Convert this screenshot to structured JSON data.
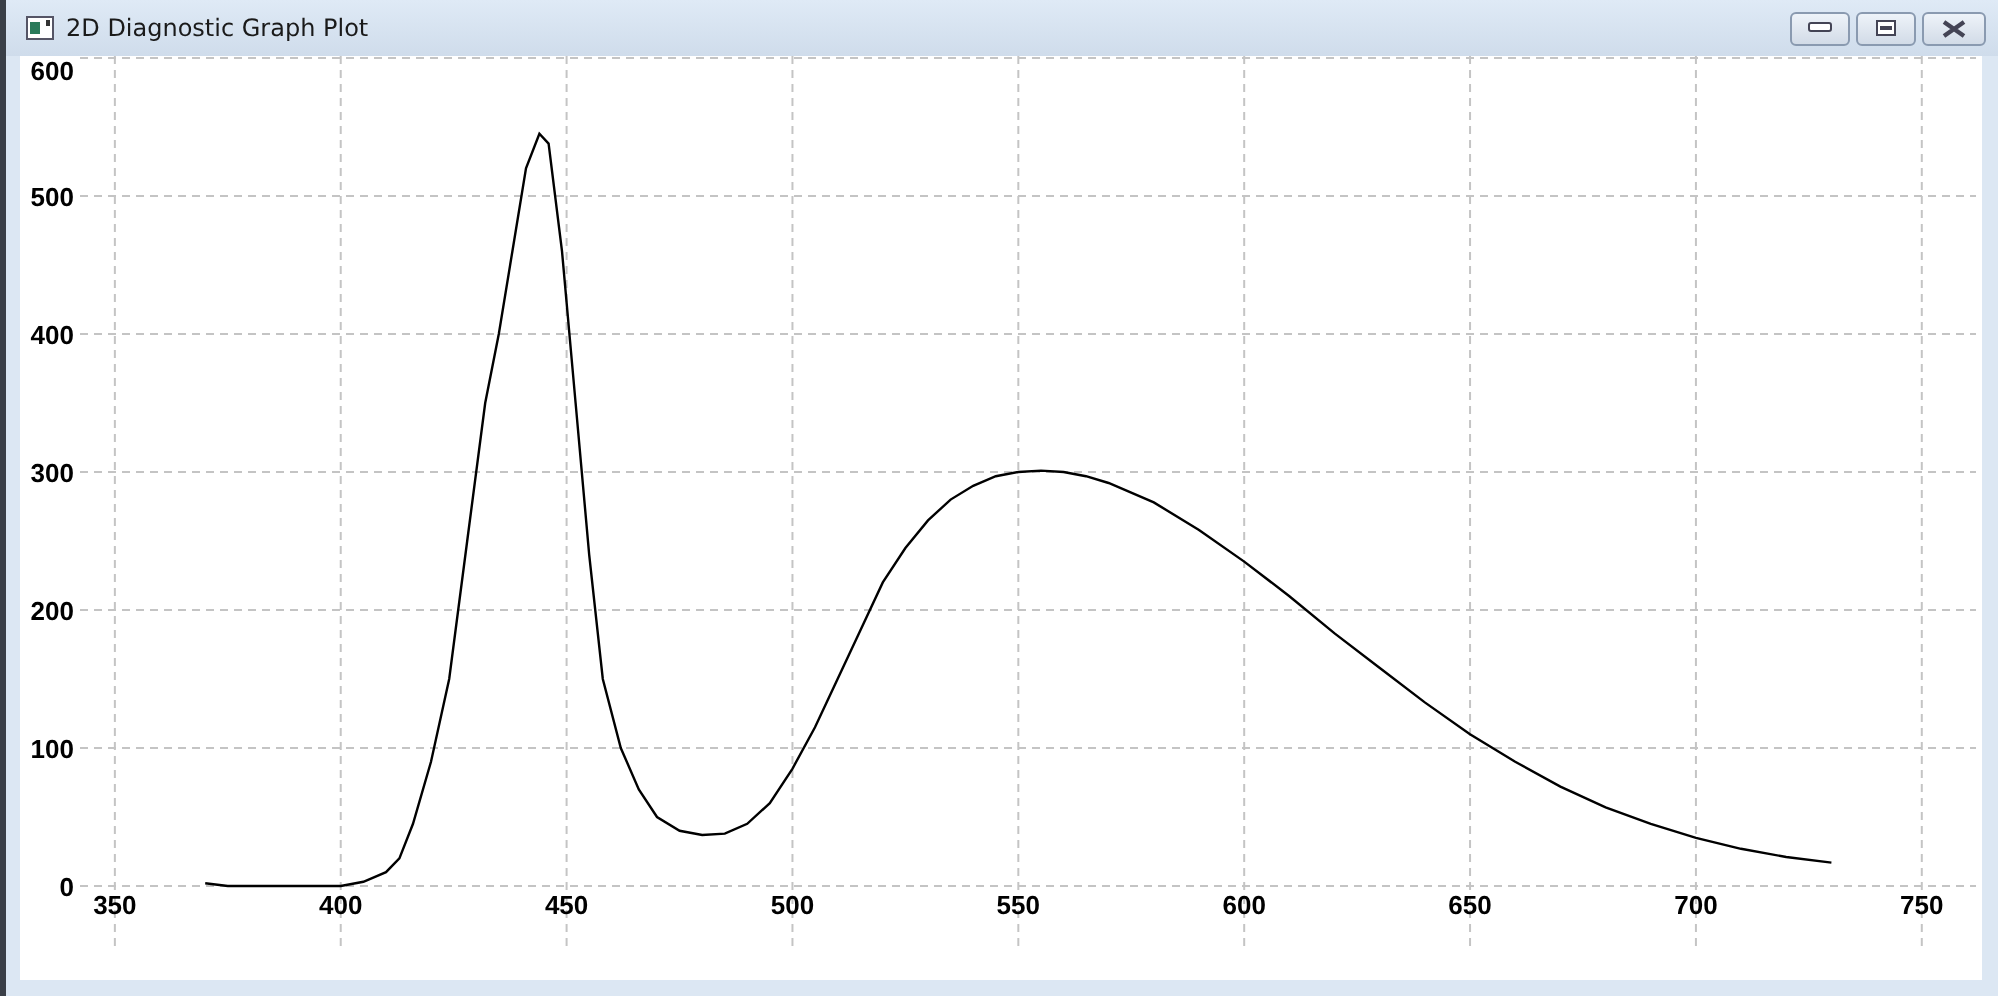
{
  "window": {
    "title": "2D Diagnostic Graph Plot"
  },
  "plot": {
    "chart_data": {
      "type": "line",
      "grid": true,
      "xlim": [
        329,
        762
      ],
      "ylim": [
        0,
        600
      ],
      "xticks": [
        350,
        400,
        450,
        500,
        550,
        600,
        650,
        700,
        750
      ],
      "yticks": [
        0,
        100,
        200,
        300,
        400,
        500,
        600
      ],
      "x": [
        370,
        375,
        380,
        390,
        400,
        405,
        410,
        413,
        416,
        420,
        424,
        428,
        432,
        435,
        438,
        441,
        444,
        446,
        449,
        452,
        455,
        458,
        462,
        466,
        470,
        475,
        480,
        485,
        490,
        495,
        500,
        505,
        510,
        515,
        520,
        525,
        530,
        535,
        540,
        545,
        550,
        555,
        560,
        565,
        570,
        580,
        590,
        600,
        610,
        620,
        630,
        640,
        650,
        660,
        670,
        680,
        690,
        700,
        710,
        720,
        730
      ],
      "series": [
        {
          "color": "#000000",
          "values": [
            2,
            0,
            0,
            0,
            0,
            3,
            10,
            20,
            45,
            90,
            150,
            250,
            350,
            400,
            460,
            520,
            545,
            538,
            460,
            350,
            240,
            150,
            100,
            70,
            50,
            40,
            37,
            38,
            45,
            60,
            85,
            115,
            150,
            185,
            220,
            245,
            265,
            280,
            290,
            297,
            300,
            301,
            300,
            297,
            292,
            278,
            258,
            235,
            210,
            183,
            158,
            133,
            110,
            90,
            72,
            57,
            45,
            35,
            27,
            21,
            17
          ]
        }
      ]
    }
  }
}
